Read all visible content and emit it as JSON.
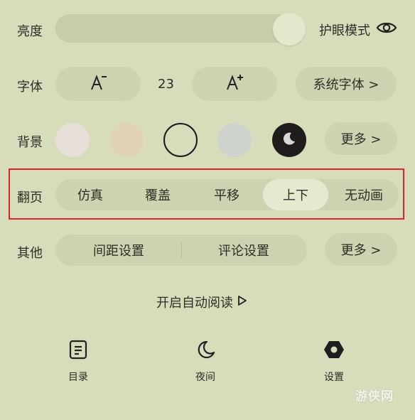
{
  "brightness": {
    "label": "亮度",
    "level_fraction": 0.93,
    "eye_mode_label": "护眼模式",
    "eye_icon": "eye-icon"
  },
  "font": {
    "label": "字体",
    "decrease_icon": "font-decrease-icon",
    "size": "23",
    "increase_icon": "font-increase-icon",
    "system_font_label": "系统字体 >"
  },
  "background": {
    "label": "背景",
    "swatches": [
      "#e6e0d9",
      "#e2d3b8",
      "#d7dcbb",
      "#cfd3cd",
      "#201c1c"
    ],
    "selected_index": 2,
    "more_label": "更多 >"
  },
  "page_turn": {
    "label": "翻页",
    "options": [
      "仿真",
      "覆盖",
      "平移",
      "上下",
      "无动画"
    ],
    "selected_index": 3
  },
  "other": {
    "label": "其他",
    "spacing_label": "间距设置",
    "comment_label": "评论设置",
    "more_label": "更多 >"
  },
  "auto_read": {
    "label": "开启自动阅读"
  },
  "tabs": [
    {
      "label": "目录",
      "icon": "catalog-icon"
    },
    {
      "label": "夜间",
      "icon": "moon-icon"
    },
    {
      "label": "设置",
      "icon": "settings-icon"
    }
  ],
  "watermark": "游侠网",
  "colors": {
    "background": "#d7dcbb",
    "highlight_border": "#e0242a"
  }
}
